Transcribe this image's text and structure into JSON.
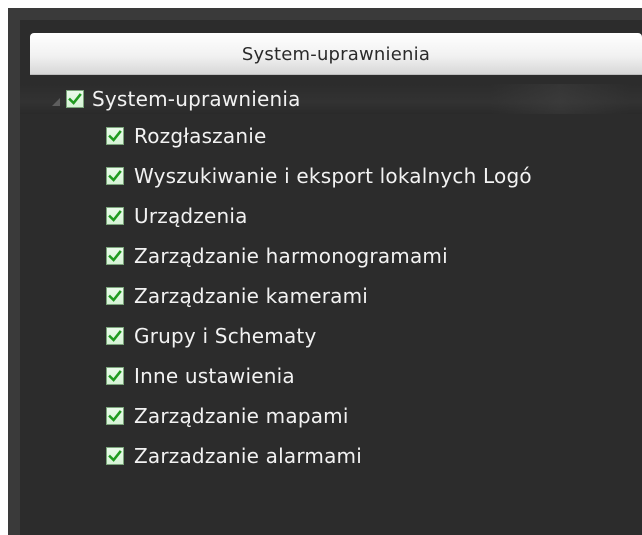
{
  "panel": {
    "header_title": "System-uprawnienia"
  },
  "tree": {
    "root": {
      "label": "System-uprawnienia",
      "checked": true,
      "expanded": true
    },
    "items": [
      {
        "label": "Rozgłaszanie",
        "checked": true
      },
      {
        "label": "Wyszukiwanie i eksport lokalnych Logó",
        "checked": true
      },
      {
        "label": "Urządzenia",
        "checked": true
      },
      {
        "label": "Zarządzanie harmonogramami",
        "checked": true
      },
      {
        "label": "Zarządzanie kamerami",
        "checked": true
      },
      {
        "label": "Grupy i Schematy",
        "checked": true
      },
      {
        "label": "Inne ustawienia",
        "checked": true
      },
      {
        "label": "Zarządzanie mapami",
        "checked": true
      },
      {
        "label": "Zarzadzanie alarmami",
        "checked": true
      }
    ]
  },
  "icons": {
    "checkbox_checked": "checkbox-checked-icon",
    "expand_triangle": "expand-triangle-icon"
  },
  "colors": {
    "background": "#2c2c2c",
    "header_bg": "#eeeeee",
    "text": "#f2f2f2",
    "check": "#1f9a1f"
  }
}
